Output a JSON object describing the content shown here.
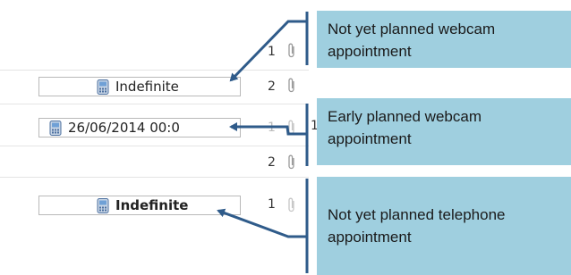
{
  "rows": [
    {
      "date": "Indefinite",
      "bold": false,
      "count": "2"
    },
    {
      "date": "26/06/2014 00:0",
      "bold": false,
      "count": "1"
    },
    {
      "date": "Indefinite",
      "bold": true,
      "count": "1"
    }
  ],
  "counts": {
    "top": "1",
    "between": "2",
    "hidden_row": "1"
  },
  "callouts": {
    "webcam_not_planned": "Not yet planned webcam\nappointment",
    "webcam_early": "Early planned webcam\nappointment",
    "phone_not_planned": "Not yet planned telephone\nappointment"
  },
  "icons": {
    "date": "phone-icon",
    "attachment": "paperclip-icon"
  },
  "colors": {
    "callout_bg": "#9fcfdf",
    "arrow": "#2f5b8a"
  }
}
